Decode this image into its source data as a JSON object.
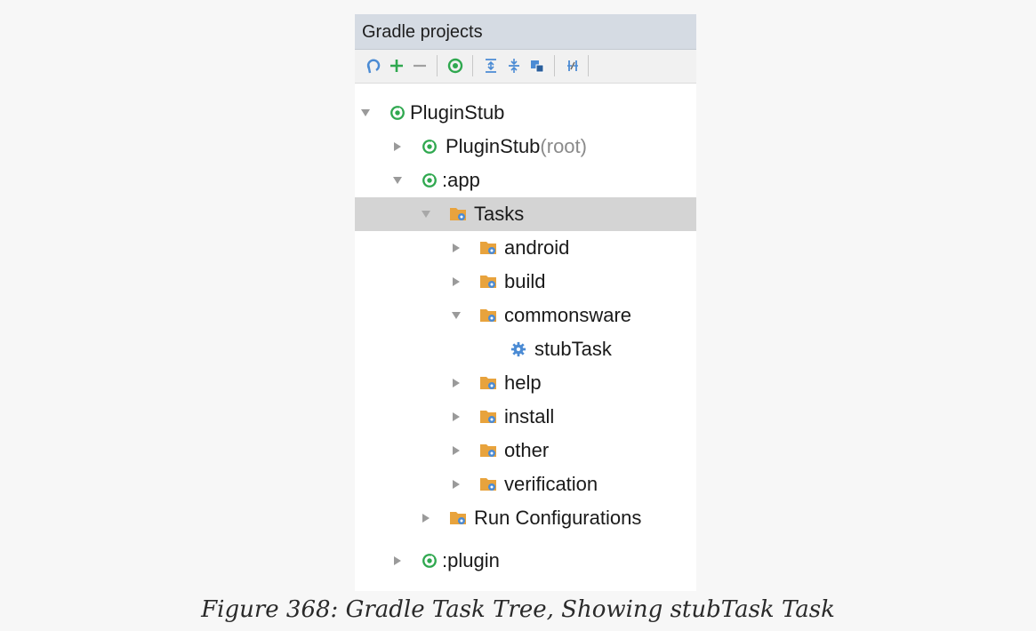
{
  "panel": {
    "title": "Gradle projects"
  },
  "toolbar": {
    "buttons": [
      {
        "icon": "refresh-icon"
      },
      {
        "icon": "add-icon"
      },
      {
        "icon": "remove-icon"
      },
      {
        "icon": "gradle-execute-icon"
      },
      {
        "icon": "expand-all-icon"
      },
      {
        "icon": "collapse-all-icon"
      },
      {
        "icon": "group-tasks-icon"
      },
      {
        "icon": "toggle-offline-icon"
      }
    ]
  },
  "tree": {
    "root": {
      "label": "PluginStub",
      "expanded": true
    },
    "root_project": {
      "label": "PluginStub",
      "suffix": "(root)",
      "expanded": false
    },
    "app": {
      "label": ":app",
      "expanded": true
    },
    "tasks": {
      "label": "Tasks",
      "expanded": true,
      "selected": true
    },
    "task_groups": {
      "android": "android",
      "build": "build",
      "commonsware": "commonsware",
      "help": "help",
      "install": "install",
      "other": "other",
      "verification": "verification"
    },
    "stub_task": {
      "label": "stubTask"
    },
    "run_configurations": {
      "label": "Run Configurations"
    },
    "plugin": {
      "label": ":plugin",
      "expanded": false
    }
  },
  "caption": "Figure 368: Gradle Task Tree, Showing stubTask Task",
  "colors": {
    "gradle_green": "#2fa84f",
    "folder_orange": "#e8a33d",
    "gear_blue": "#4b8bd4",
    "selection": "#d4d4d4",
    "header_bg": "#d5dbe3"
  }
}
